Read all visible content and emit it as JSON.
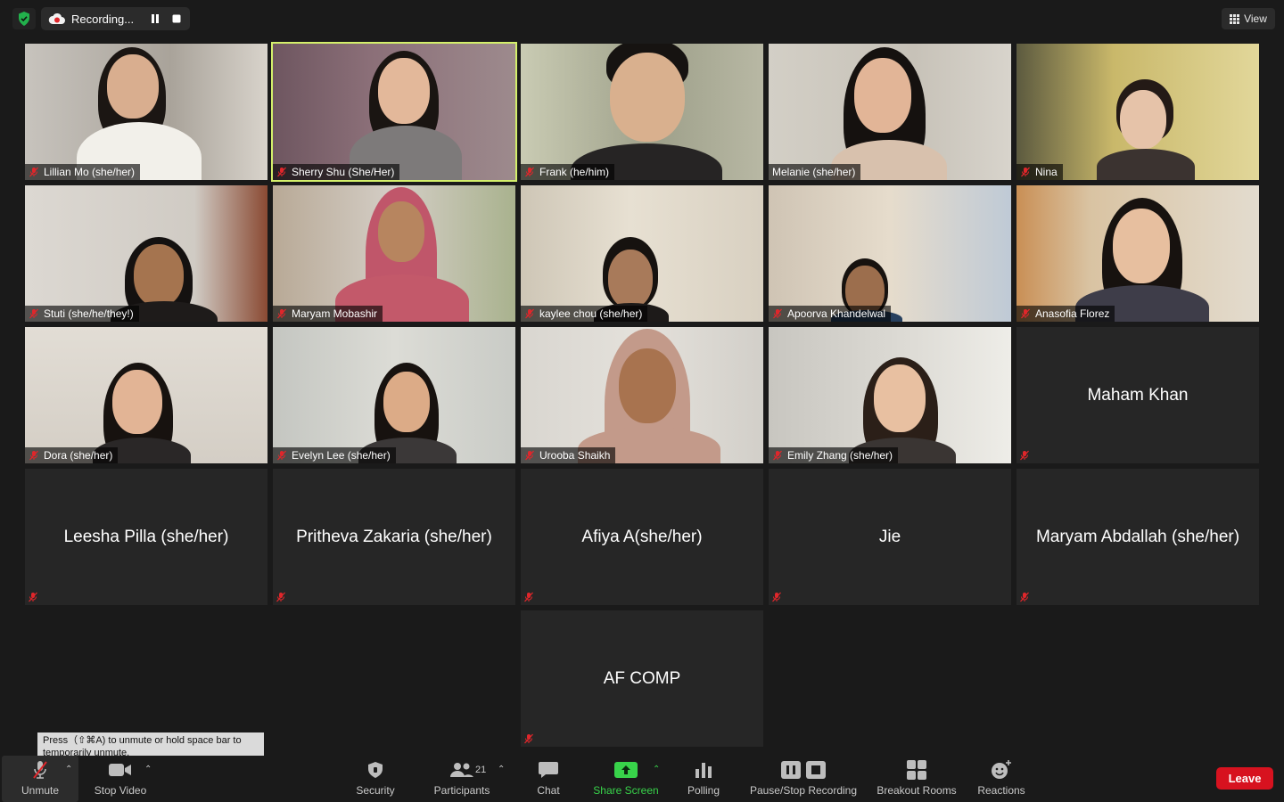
{
  "top": {
    "recording_label": "Recording...",
    "view_label": "View"
  },
  "tiles": [
    {
      "name": "Lillian Mo (she/her)",
      "type": "video"
    },
    {
      "name": "Sherry Shu (She/Her)",
      "type": "video",
      "speaking": true
    },
    {
      "name": "Frank (he/him)",
      "type": "video"
    },
    {
      "name": "Melanie (she/her)",
      "type": "video"
    },
    {
      "name": "Nina",
      "type": "video"
    },
    {
      "name": "Stuti (she/he/they!)",
      "type": "video"
    },
    {
      "name": "Maryam Mobashir",
      "type": "video"
    },
    {
      "name": "kaylee chou (she/her)",
      "type": "video"
    },
    {
      "name": "Apoorva Khandelwal",
      "type": "video"
    },
    {
      "name": "Anasofia Florez",
      "type": "video"
    },
    {
      "name": "Dora (she/her)",
      "type": "video"
    },
    {
      "name": "Evelyn Lee (she/her)",
      "type": "video"
    },
    {
      "name": "Urooba Shaikh",
      "type": "video"
    },
    {
      "name": "Emily Zhang (she/her)",
      "type": "video"
    },
    {
      "name": "Maham Khan",
      "type": "name"
    },
    {
      "name": "Leesha Pilla (she/her)",
      "type": "name"
    },
    {
      "name": "Pritheva Zakaria (she/her)",
      "type": "name"
    },
    {
      "name": "Afiya A(she/her)",
      "type": "name"
    },
    {
      "name": "Jie",
      "type": "name"
    },
    {
      "name": "Maryam Abdallah (she/her)",
      "type": "name"
    },
    {
      "name": "AF COMP",
      "type": "name"
    }
  ],
  "tooltip": "Press（⇧⌘A) to unmute or hold space bar to temporarily unmute.",
  "toolbar": {
    "unmute": "Unmute",
    "stop_video": "Stop Video",
    "security": "Security",
    "participants": "Participants",
    "participant_count": "21",
    "chat": "Chat",
    "share_screen": "Share Screen",
    "polling": "Polling",
    "pause_stop_recording": "Pause/Stop Recording",
    "breakout_rooms": "Breakout Rooms",
    "reactions": "Reactions",
    "leave": "Leave"
  },
  "colors": {
    "active_speaker": "#d4f06b",
    "share_green": "#38d34a",
    "leave_red": "#d7121f",
    "mute_red": "#e0262b"
  }
}
